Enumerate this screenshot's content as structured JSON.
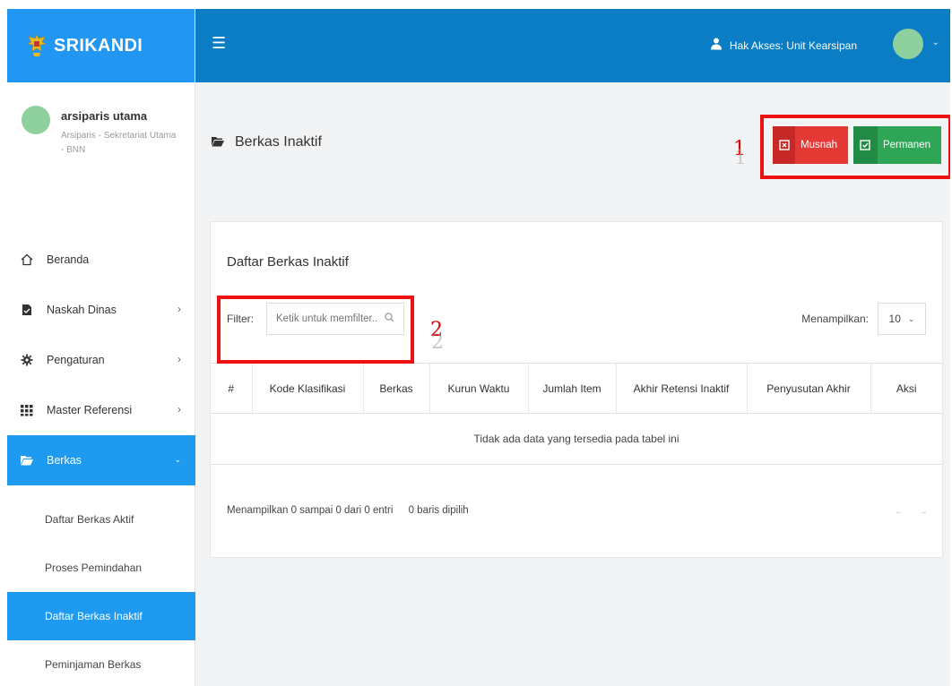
{
  "app": {
    "brand": "SRIKANDI"
  },
  "profile": {
    "name": "arsiparis utama",
    "role": "Arsiparis - Sekretariat Utama - BNN"
  },
  "nav": {
    "items": [
      {
        "label": "Beranda",
        "icon": "home-icon"
      },
      {
        "label": "Naskah Dinas",
        "icon": "document-icon"
      },
      {
        "label": "Pengaturan",
        "icon": "gear-icon"
      },
      {
        "label": "Master Referensi",
        "icon": "grid-icon"
      },
      {
        "label": "Berkas",
        "icon": "folder-icon"
      }
    ],
    "sub_items": [
      {
        "label": "Daftar Berkas Aktif"
      },
      {
        "label": "Proses Pemindahan"
      },
      {
        "label": "Daftar Berkas Inaktif"
      },
      {
        "label": "Peminjaman Berkas"
      }
    ]
  },
  "topbar": {
    "access_label": "Hak Akses: Unit Kearsipan"
  },
  "page": {
    "title": "Berkas Inaktif",
    "buttons": {
      "musnah": "Musnah",
      "permanen": "Permanen"
    }
  },
  "annotations": {
    "one": "1",
    "two": "2"
  },
  "card": {
    "title": "Daftar Berkas Inaktif",
    "filter_label": "Filter:",
    "filter_placeholder": "Ketik untuk memfilter...",
    "show_label": "Menampilkan:",
    "show_value": "10",
    "columns": [
      "#",
      "Kode Klasifikasi",
      "Berkas",
      "Kurun Waktu",
      "Jumlah Item",
      "Akhir Retensi Inaktif",
      "Penyusutan Akhir",
      "Aksi"
    ],
    "empty_message": "Tidak ada data yang tersedia pada tabel ini",
    "info": "Menampilkan 0 sampai 0 dari 0 entri",
    "selected": "0 baris dipilih",
    "pager": {
      "prev": "←",
      "next": "→"
    }
  },
  "colors": {
    "primary": "#2196f3",
    "topbar": "#0b7dc4",
    "danger": "#e53935",
    "success": "#2ea655",
    "annotation": "#ee1111"
  }
}
